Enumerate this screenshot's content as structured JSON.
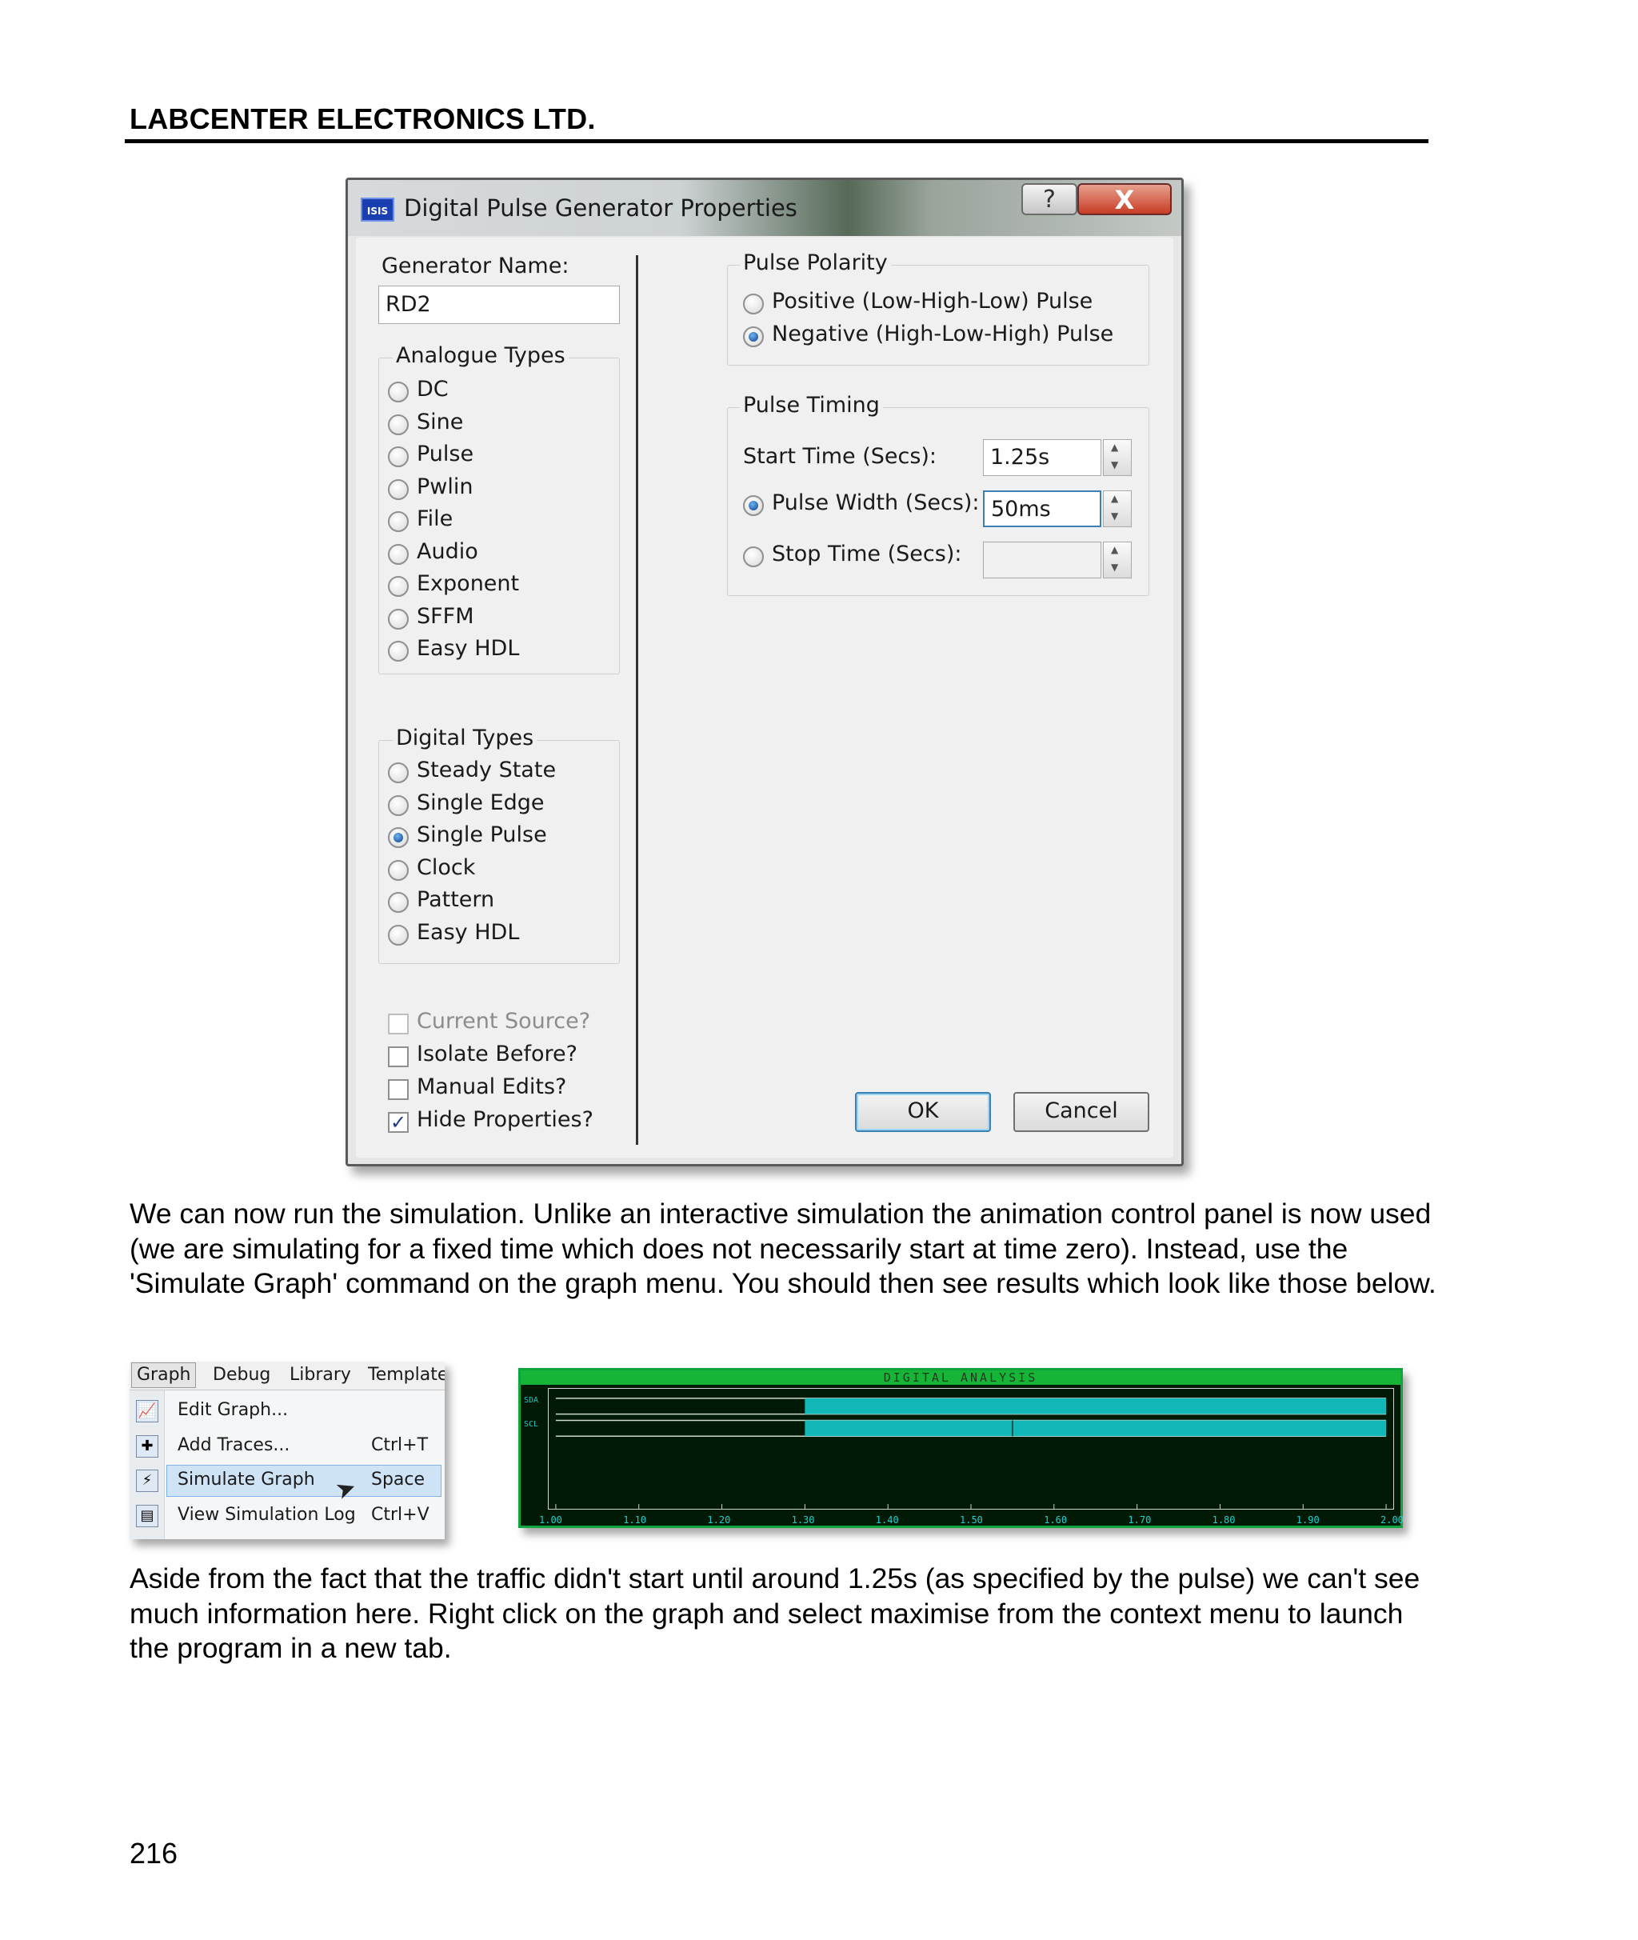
{
  "header": {
    "title": "LABCENTER ELECTRONICS LTD."
  },
  "dialog": {
    "icon_text": "ISIS",
    "title": "Digital Pulse Generator Properties",
    "help_label": "?",
    "close_label": "X",
    "generator_name_label": "Generator Name:",
    "generator_name_value": "RD2",
    "analogue_group_title": "Analogue Types",
    "analogue_types": [
      {
        "label": "DC",
        "selected": false
      },
      {
        "label": "Sine",
        "selected": false
      },
      {
        "label": "Pulse",
        "selected": false
      },
      {
        "label": "Pwlin",
        "selected": false
      },
      {
        "label": "File",
        "selected": false
      },
      {
        "label": "Audio",
        "selected": false
      },
      {
        "label": "Exponent",
        "selected": false
      },
      {
        "label": "SFFM",
        "selected": false
      },
      {
        "label": "Easy HDL",
        "selected": false
      }
    ],
    "digital_group_title": "Digital Types",
    "digital_types": [
      {
        "label": "Steady State",
        "selected": false
      },
      {
        "label": "Single Edge",
        "selected": false
      },
      {
        "label": "Single Pulse",
        "selected": true
      },
      {
        "label": "Clock",
        "selected": false
      },
      {
        "label": "Pattern",
        "selected": false
      },
      {
        "label": "Easy HDL",
        "selected": false
      }
    ],
    "checkboxes": [
      {
        "label": "Current Source?",
        "checked": false,
        "disabled": true
      },
      {
        "label": "Isolate Before?",
        "checked": false,
        "disabled": false
      },
      {
        "label": "Manual Edits?",
        "checked": false,
        "disabled": false
      },
      {
        "label": "Hide Properties?",
        "checked": true,
        "disabled": false
      }
    ],
    "polarity_group_title": "Pulse Polarity",
    "polarity_options": [
      {
        "label": "Positive (Low-High-Low) Pulse",
        "selected": false
      },
      {
        "label": "Negative (High-Low-High) Pulse",
        "selected": true
      }
    ],
    "timing_group_title": "Pulse Timing",
    "start_time_label": "Start Time (Secs):",
    "start_time_value": "1.25s",
    "pulse_width_label": "Pulse Width (Secs):",
    "pulse_width_value": "50ms",
    "stop_time_label": "Stop Time (Secs):",
    "stop_time_value": "",
    "ok_label": "OK",
    "cancel_label": "Cancel"
  },
  "paragraphs": {
    "p1": "We can now run the simulation. Unlike an interactive simulation the animation control panel is now used (we are simulating for a fixed time which does not necessarily start at time zero). Instead, use the 'Simulate Graph' command on the graph menu. You should then see results which look like those below.",
    "p2": "Aside from the fact that the traffic didn't start until around 1.25s (as specified by the pulse) we can't see much information here. Right click on the graph and select maximise from the context menu to launch the program in a new tab."
  },
  "menu": {
    "menubar": [
      "Graph",
      "Debug",
      "Library",
      "Template"
    ],
    "items": [
      {
        "label": "Edit Graph...",
        "shortcut": "",
        "icon": "edit-graph-icon",
        "highlighted": false
      },
      {
        "label": "Add Traces...",
        "shortcut": "Ctrl+T",
        "icon": "add-traces-icon",
        "highlighted": false
      },
      {
        "label": "Simulate Graph",
        "shortcut": "Space",
        "icon": "simulate-graph-icon",
        "highlighted": true
      },
      {
        "label": "View Simulation Log",
        "shortcut": "Ctrl+V",
        "icon": "simulation-log-icon",
        "highlighted": false
      }
    ],
    "highlight_color": "#cfe3f7"
  },
  "graph": {
    "title": "DIGITAL ANALYSIS",
    "background_color": "#001a05",
    "trace_color": "#12b8b8",
    "traces": [
      {
        "name": "SDA",
        "active_from": 1.3,
        "active_to": 2.0
      },
      {
        "name": "SCL",
        "active_from": 1.3,
        "active_to": 2.0,
        "edge_at": 1.55
      }
    ],
    "x_range": [
      1.0,
      2.0
    ],
    "x_ticks": [
      "1.00",
      "1.10",
      "1.20",
      "1.30",
      "1.40",
      "1.50",
      "1.60",
      "1.70",
      "1.80",
      "1.90",
      "2.00"
    ]
  },
  "page_number": "216"
}
